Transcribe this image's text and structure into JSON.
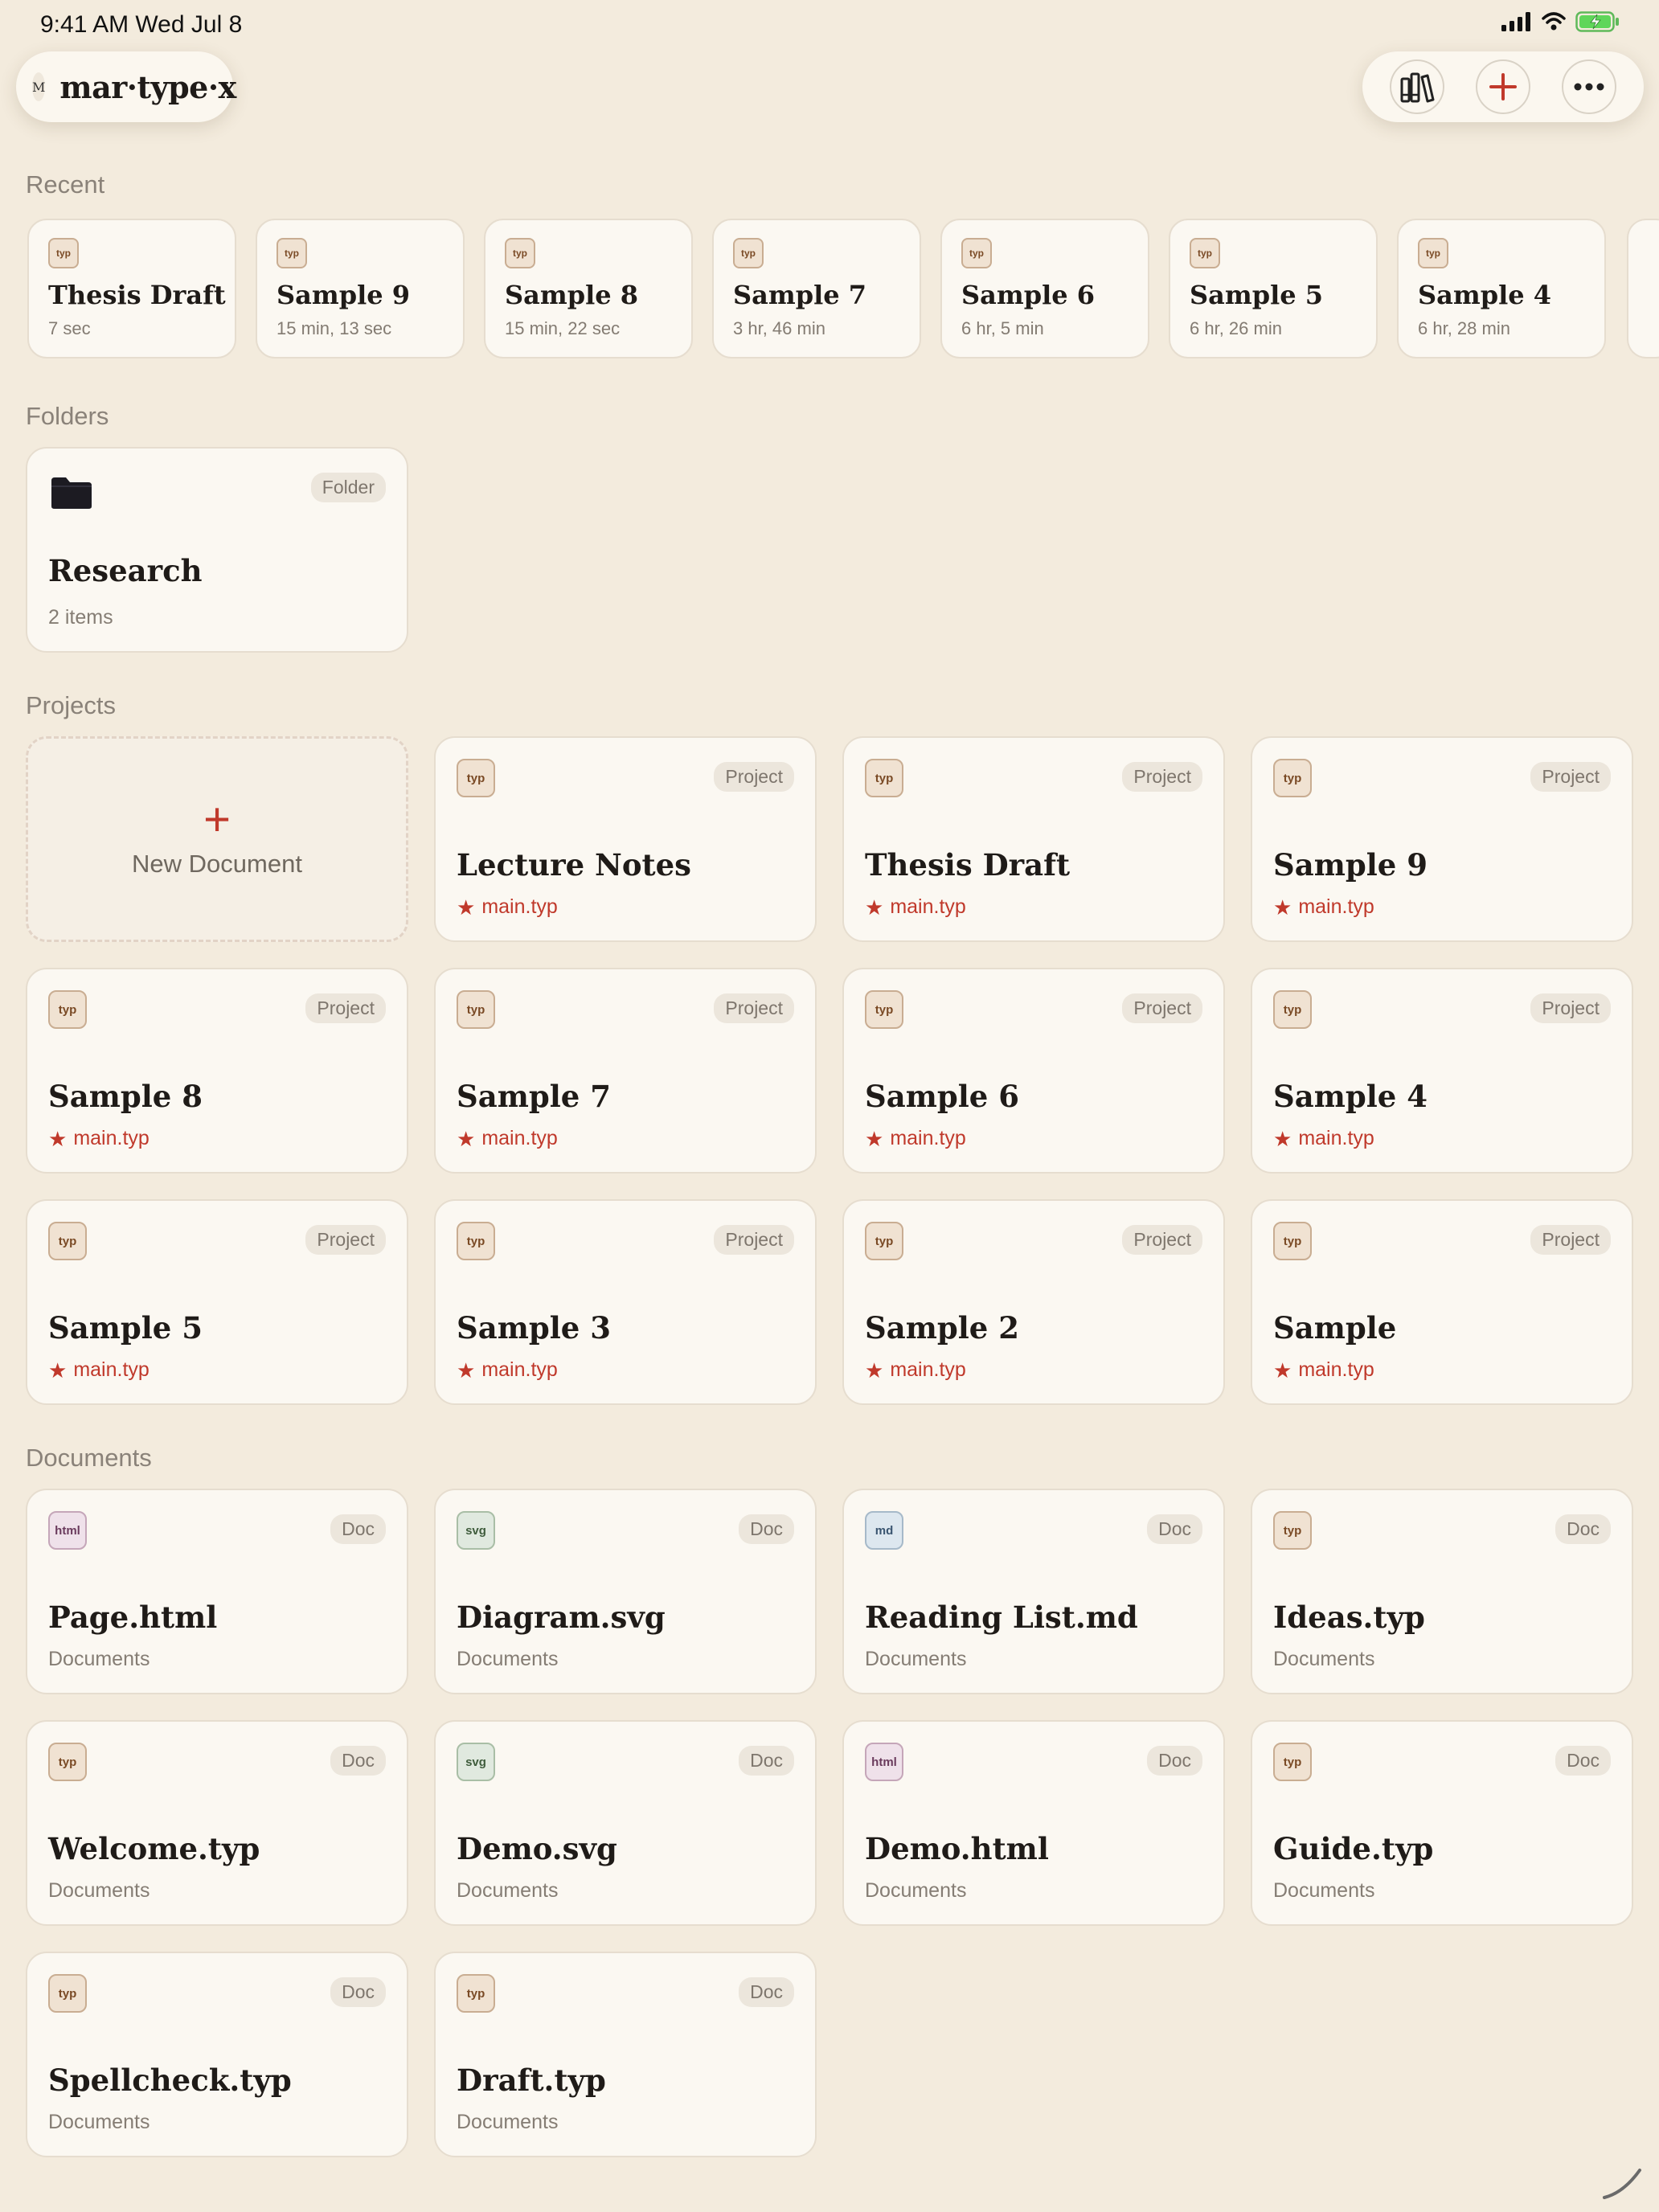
{
  "status": {
    "time_date": "9:41 AM   Wed Jul 8"
  },
  "header": {
    "logo_mark": "M",
    "app_name": "mar·type·x"
  },
  "sections": {
    "recent": "Recent",
    "folders": "Folders",
    "projects": "Projects",
    "documents": "Documents"
  },
  "recent": [
    {
      "icon": "typ",
      "title": "Thesis Draft",
      "time": "7 sec"
    },
    {
      "icon": "typ",
      "title": "Sample 9",
      "time": "15 min, 13 sec"
    },
    {
      "icon": "typ",
      "title": "Sample 8",
      "time": "15 min, 22 sec"
    },
    {
      "icon": "typ",
      "title": "Sample 7",
      "time": "3 hr, 46 min"
    },
    {
      "icon": "typ",
      "title": "Sample 6",
      "time": "6 hr, 5 min"
    },
    {
      "icon": "typ",
      "title": "Sample 5",
      "time": "6 hr, 26 min"
    },
    {
      "icon": "typ",
      "title": "Sample 4",
      "time": "6 hr, 28 min"
    }
  ],
  "folder": {
    "badge": "Folder",
    "title": "Research",
    "count": "2 items"
  },
  "new_document": {
    "label": "New Document",
    "plus": "+"
  },
  "projects": [
    {
      "icon": "typ",
      "badge": "Project",
      "title": "Lecture Notes",
      "main": "main.typ"
    },
    {
      "icon": "typ",
      "badge": "Project",
      "title": "Thesis Draft",
      "main": "main.typ"
    },
    {
      "icon": "typ",
      "badge": "Project",
      "title": "Sample 9",
      "main": "main.typ"
    },
    {
      "icon": "typ",
      "badge": "Project",
      "title": "Sample 8",
      "main": "main.typ"
    },
    {
      "icon": "typ",
      "badge": "Project",
      "title": "Sample 7",
      "main": "main.typ"
    },
    {
      "icon": "typ",
      "badge": "Project",
      "title": "Sample 6",
      "main": "main.typ"
    },
    {
      "icon": "typ",
      "badge": "Project",
      "title": "Sample 4",
      "main": "main.typ"
    },
    {
      "icon": "typ",
      "badge": "Project",
      "title": "Sample 5",
      "main": "main.typ"
    },
    {
      "icon": "typ",
      "badge": "Project",
      "title": "Sample 3",
      "main": "main.typ"
    },
    {
      "icon": "typ",
      "badge": "Project",
      "title": "Sample 2",
      "main": "main.typ"
    },
    {
      "icon": "typ",
      "badge": "Project",
      "title": "Sample",
      "main": "main.typ"
    }
  ],
  "documents": [
    {
      "icon": "html",
      "badge": "Doc",
      "title": "Page.html",
      "location": "Documents"
    },
    {
      "icon": "svg",
      "badge": "Doc",
      "title": "Diagram.svg",
      "location": "Documents"
    },
    {
      "icon": "md",
      "badge": "Doc",
      "title": "Reading List.md",
      "location": "Documents"
    },
    {
      "icon": "typ",
      "badge": "Doc",
      "title": "Ideas.typ",
      "location": "Documents"
    },
    {
      "icon": "typ",
      "badge": "Doc",
      "title": "Welcome.typ",
      "location": "Documents"
    },
    {
      "icon": "svg",
      "badge": "Doc",
      "title": "Demo.svg",
      "location": "Documents"
    },
    {
      "icon": "html",
      "badge": "Doc",
      "title": "Demo.html",
      "location": "Documents"
    },
    {
      "icon": "typ",
      "badge": "Doc",
      "title": "Guide.typ",
      "location": "Documents"
    },
    {
      "icon": "typ",
      "badge": "Doc",
      "title": "Spellcheck.typ",
      "location": "Documents"
    },
    {
      "icon": "typ",
      "badge": "Doc",
      "title": "Draft.typ",
      "location": "Documents"
    }
  ],
  "colors": {
    "background": "#f3ebdd",
    "accent": "#c0392b",
    "card": "#fbf8f2"
  },
  "icons": {
    "library": "library-icon",
    "add": "plus-icon",
    "more": "ellipsis-icon",
    "folder": "folder-icon",
    "star": "star-icon"
  }
}
